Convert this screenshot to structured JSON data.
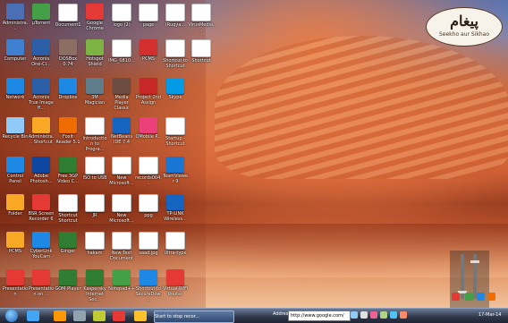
{
  "branding": {
    "title": "پیغام",
    "subtitle": "Seekho aur Sikhao"
  },
  "desktop_icons": [
    {
      "label": "Administra...",
      "icon": "admin-icon",
      "color": "#4a6fb5"
    },
    {
      "label": "μTorrent",
      "icon": "torrent-icon",
      "color": "#43a047"
    },
    {
      "label": "Document1",
      "icon": "document-icon",
      "color": "#ffffff"
    },
    {
      "label": "Google Chrome",
      "icon": "chrome-icon",
      "color": "#e53935"
    },
    {
      "label": "logo (2)",
      "icon": "image-icon",
      "color": "#ffffff"
    },
    {
      "label": "page",
      "icon": "page-icon",
      "color": "#ffffff"
    },
    {
      "label": "(Ruqya...",
      "icon": "document-icon",
      "color": "#ffffff"
    },
    {
      "label": "VirusMedia...",
      "icon": "app-icon",
      "color": "#ffffff"
    },
    {
      "label": "Computer",
      "icon": "computer-icon",
      "color": "#3f7fd0"
    },
    {
      "label": "Acronis One-Cl...",
      "icon": "acronis-icon",
      "color": "#2a5fa8"
    },
    {
      "label": "DOSBox 0.74",
      "icon": "dosbox-icon",
      "color": "#8d6e63"
    },
    {
      "label": "Hotspot Shield",
      "icon": "hotspot-icon",
      "color": "#7cb342"
    },
    {
      "label": "IMG_0810...",
      "icon": "image-icon",
      "color": "#ffffff"
    },
    {
      "label": "PCMS",
      "icon": "flag-icon",
      "color": "#d32f2f"
    },
    {
      "label": "Shortcut to Shortcut",
      "icon": "shortcut-icon",
      "color": "#ffffff"
    },
    {
      "label": "Shortcut",
      "icon": "shortcut-icon",
      "color": "#ffffff"
    },
    {
      "label": "Network",
      "icon": "network-icon",
      "color": "#1e88e5"
    },
    {
      "label": "Acronis True Image H...",
      "icon": "acronis-icon",
      "color": "#2a5fa8"
    },
    {
      "label": "Dropbox",
      "icon": "dropbox-icon",
      "color": "#1e88e5"
    },
    {
      "label": "3M Magician",
      "icon": "magician-icon",
      "color": "#607d8b"
    },
    {
      "label": "Media Player Classic",
      "icon": "media-icon",
      "color": "#6d4c41"
    },
    {
      "label": "Project 2nd Assign",
      "icon": "project-icon",
      "color": "#c62828"
    },
    {
      "label": "Skype",
      "icon": "skype-icon",
      "color": "#039be5"
    },
    {
      "label": "Recycle Bin",
      "icon": "recycle-icon",
      "color": "#90caf9"
    },
    {
      "label": "Administra... Shortcut",
      "icon": "folder-icon",
      "color": "#f9a825"
    },
    {
      "label": "Foxit Reader 5.1",
      "icon": "foxit-icon",
      "color": "#ef6c00"
    },
    {
      "label": "Introduction to Progra...",
      "icon": "document-icon",
      "color": "#ffffff"
    },
    {
      "label": "NetBeans IDE 7.4",
      "icon": "netbeans-icon",
      "color": "#1565c0"
    },
    {
      "label": "QMobile P...",
      "icon": "qmobile-icon",
      "color": "#ec407a"
    },
    {
      "label": "Startup - Shortcut",
      "icon": "startup-icon",
      "color": "#ffffff"
    },
    {
      "label": "Control Panel",
      "icon": "control-panel-icon",
      "color": "#1e88e5"
    },
    {
      "label": "Adobe Photosh...",
      "icon": "photoshop-icon",
      "color": "#0d47a1"
    },
    {
      "label": "Free 3GP Video C...",
      "icon": "video-icon",
      "color": "#2e7d32"
    },
    {
      "label": "ISO to USB",
      "icon": "iso-icon",
      "color": "#ffffff"
    },
    {
      "label": "New Microsoft...",
      "icon": "document-icon",
      "color": "#ffffff"
    },
    {
      "label": "records004...",
      "icon": "document-icon",
      "color": "#ffffff"
    },
    {
      "label": "TeamViewer 9",
      "icon": "teamviewer-icon",
      "color": "#1976d2"
    },
    {
      "label": "Folder",
      "icon": "folder-icon",
      "color": "#f9a825"
    },
    {
      "label": "BSR Screen Recorder 6",
      "icon": "bsr-icon",
      "color": "#e53935"
    },
    {
      "label": "Shortcut Shortcut",
      "icon": "shortcut-icon",
      "color": "#ffffff"
    },
    {
      "label": "JR",
      "icon": "document-icon",
      "color": "#ffffff"
    },
    {
      "label": "New Microsoft...",
      "icon": "document-icon",
      "color": "#ffffff"
    },
    {
      "label": "ppg",
      "icon": "document-icon",
      "color": "#ffffff"
    },
    {
      "label": "TP-LINK Wireless...",
      "icon": "tplink-icon",
      "color": "#1565c0"
    },
    {
      "label": "PCMS",
      "icon": "folder-icon",
      "color": "#f9a825"
    },
    {
      "label": "CyberLink YouCam",
      "icon": "youcam-icon",
      "color": "#1e88e5"
    },
    {
      "label": "Ginger",
      "icon": "ginger-icon",
      "color": "#2e7d32"
    },
    {
      "label": "hakam",
      "icon": "image-icon",
      "color": "#ffffff"
    },
    {
      "label": "New Text Document",
      "icon": "document-icon",
      "color": "#ffffff"
    },
    {
      "label": "saad.jpg",
      "icon": "document-icon",
      "color": "#ffffff"
    },
    {
      "label": "Ultra-type",
      "icon": "ultra-icon",
      "color": "#ffffff"
    },
    {
      "label": "Presentation",
      "icon": "presentation-icon",
      "color": "#e53935"
    },
    {
      "label": "Presentation on ...",
      "icon": "presentation-icon",
      "color": "#e53935"
    },
    {
      "label": "GOM Player",
      "icon": "gom-icon",
      "color": "#2e7d32"
    },
    {
      "label": "Kaspersky Internet Sec...",
      "icon": "kaspersky-icon",
      "color": "#2e7d32"
    },
    {
      "label": "Notepad++",
      "icon": "notepad-icon",
      "color": "#43a047"
    },
    {
      "label": "Shortcut to SecureDow...",
      "icon": "secure-icon",
      "color": "#1e88e5"
    },
    {
      "label": "Virtual WiFi Router",
      "icon": "router-icon",
      "color": "#e53935"
    }
  ],
  "widget": {
    "slider_levels": [
      0.1,
      0.85
    ],
    "icons": [
      {
        "name": "winamp-icon",
        "color": "#e53935"
      },
      {
        "name": "media-icon",
        "color": "#43a047"
      },
      {
        "name": "app-icon",
        "color": "#1e88e5"
      },
      {
        "name": "app-icon",
        "color": "#ef6c00"
      }
    ]
  },
  "taskbar": {
    "items": [
      {
        "name": "ie-icon",
        "color": "#42a5f5"
      },
      {
        "name": "media-player-icon",
        "color": "#ff9800"
      },
      {
        "name": "app-icon",
        "color": "#90a4ae"
      },
      {
        "name": "chrome-icon",
        "color": "#e53935"
      },
      {
        "name": "explorer-icon",
        "color": "#fbc02d"
      },
      {
        "name": "app-icon",
        "color": "#c0ca33"
      }
    ],
    "active_button_label": "Start to stop recor...",
    "address_label": "Address",
    "address_value": "http://www.google.com/",
    "time": "17-Mar-14",
    "tray_icons": [
      {
        "name": "network-tray-icon",
        "color": "#90caf9"
      },
      {
        "name": "volume-tray-icon",
        "color": "#e0e0e0"
      },
      {
        "name": "app-tray-icon",
        "color": "#f06292"
      },
      {
        "name": "app-tray-icon",
        "color": "#aed581"
      },
      {
        "name": "app-tray-icon",
        "color": "#4fc3f7"
      },
      {
        "name": "app-tray-icon",
        "color": "#ff8a65"
      }
    ]
  }
}
